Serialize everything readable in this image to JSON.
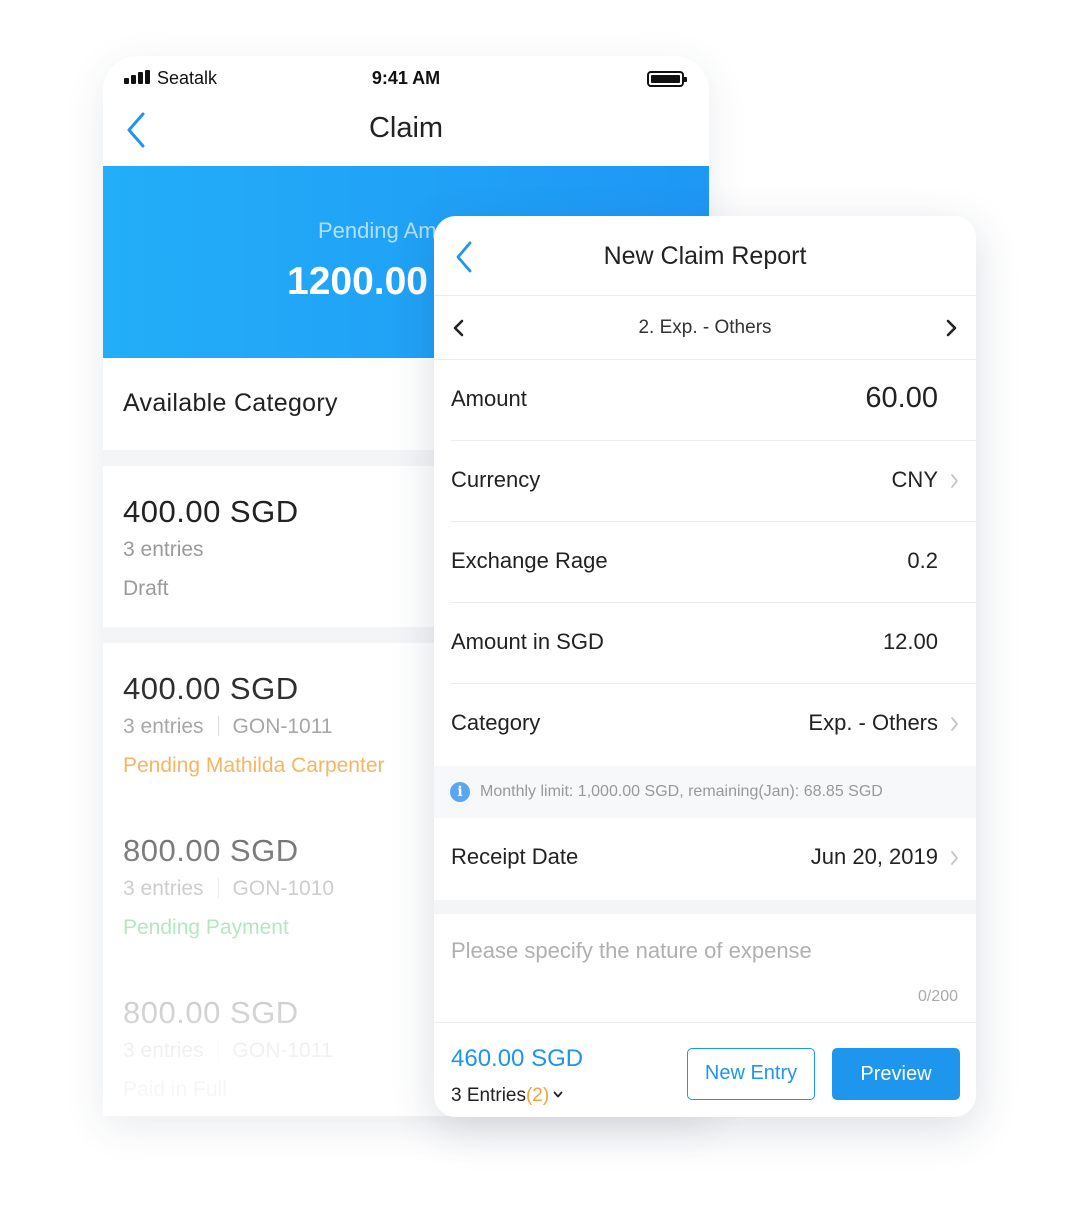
{
  "status_bar": {
    "carrier": "Seatalk",
    "time": "9:41 AM"
  },
  "claim_screen": {
    "title": "Claim",
    "pending_label": "Pending Am",
    "pending_amount": "1200.00",
    "available_category": "Available Category",
    "claims": [
      {
        "amount": "400.00 SGD",
        "entries": "3 entries",
        "code": "",
        "status": "Draft",
        "status_color": "#9a9a9a"
      },
      {
        "amount": "400.00 SGD",
        "entries": "3 entries",
        "code": "GON-1011",
        "status": "Pending Mathilda Carpenter",
        "status_color": "#f4a33a"
      },
      {
        "amount": "800.00 SGD",
        "entries": "3 entries",
        "code": "GON-1010",
        "status": "Pending Payment",
        "status_color": "#3fbf5a"
      },
      {
        "amount": "800.00 SGD",
        "entries": "3 entries",
        "code": "GON-1011",
        "status": "Paid in Full",
        "status_color": "#9a9a9a"
      }
    ]
  },
  "report": {
    "title": "New Claim Report",
    "pager_label": "2. Exp. - Others",
    "fields": {
      "amount_label": "Amount",
      "amount_value": "60.00",
      "currency_label": "Currency",
      "currency_value": "CNY",
      "exchange_label": "Exchange Rage",
      "exchange_value": "0.2",
      "amount_sgd_label": "Amount in SGD",
      "amount_sgd_value": "12.00",
      "category_label": "Category",
      "category_value": "Exp. - Others",
      "receipt_label": "Receipt Date",
      "receipt_value": "Jun 20, 2019"
    },
    "hint": "Monthly limit: 1,000.00 SGD, remaining(Jan): 68.85 SGD",
    "note_placeholder": "Please specify the nature of expense",
    "note_count": "0/200",
    "footer": {
      "total": "460.00 SGD",
      "entries_label": "3 Entries",
      "entries_pending": "(2)",
      "new_entry": "New Entry",
      "preview": "Preview"
    }
  },
  "colors": {
    "accent": "#1e96ee",
    "warning": "#f4a33a",
    "success": "#3fbf5a"
  }
}
